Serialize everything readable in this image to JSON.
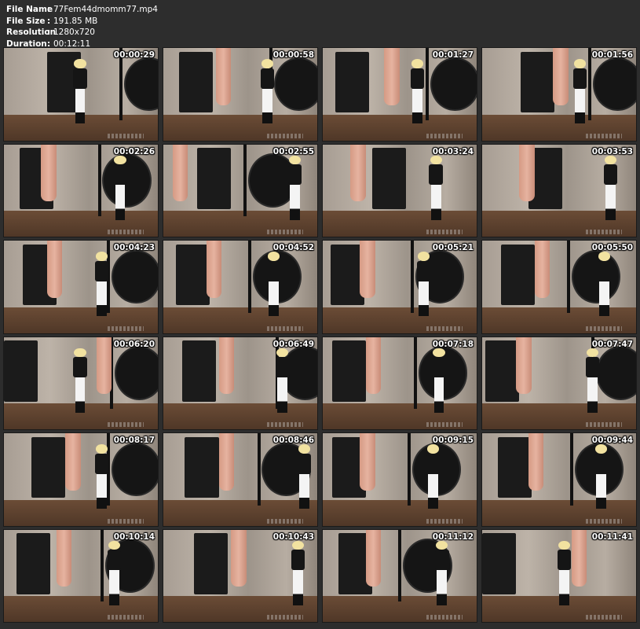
{
  "info": {
    "rows": [
      {
        "key": "File Name",
        "sep": ":",
        "value": "77Fem44dmomm77.mp4"
      },
      {
        "key": "File Size",
        "sep": ":",
        "value": "191.85 MB"
      },
      {
        "key": "Resolution",
        "sep": ":",
        "value": "1280x720"
      },
      {
        "key": "Duration",
        "sep": ":",
        "value": "00:12:11"
      }
    ]
  },
  "thumbnails": [
    {
      "timestamp": "00:00:29"
    },
    {
      "timestamp": "00:00:58"
    },
    {
      "timestamp": "00:01:27"
    },
    {
      "timestamp": "00:01:56"
    },
    {
      "timestamp": "00:02:26"
    },
    {
      "timestamp": "00:02:55"
    },
    {
      "timestamp": "00:03:24"
    },
    {
      "timestamp": "00:03:53"
    },
    {
      "timestamp": "00:04:23"
    },
    {
      "timestamp": "00:04:52"
    },
    {
      "timestamp": "00:05:21"
    },
    {
      "timestamp": "00:05:50"
    },
    {
      "timestamp": "00:06:20"
    },
    {
      "timestamp": "00:06:49"
    },
    {
      "timestamp": "00:07:18"
    },
    {
      "timestamp": "00:07:47"
    },
    {
      "timestamp": "00:08:17"
    },
    {
      "timestamp": "00:08:46"
    },
    {
      "timestamp": "00:09:15"
    },
    {
      "timestamp": "00:09:44"
    },
    {
      "timestamp": "00:10:14"
    },
    {
      "timestamp": "00:10:43"
    },
    {
      "timestamp": "00:11:12"
    },
    {
      "timestamp": "00:11:41"
    }
  ]
}
